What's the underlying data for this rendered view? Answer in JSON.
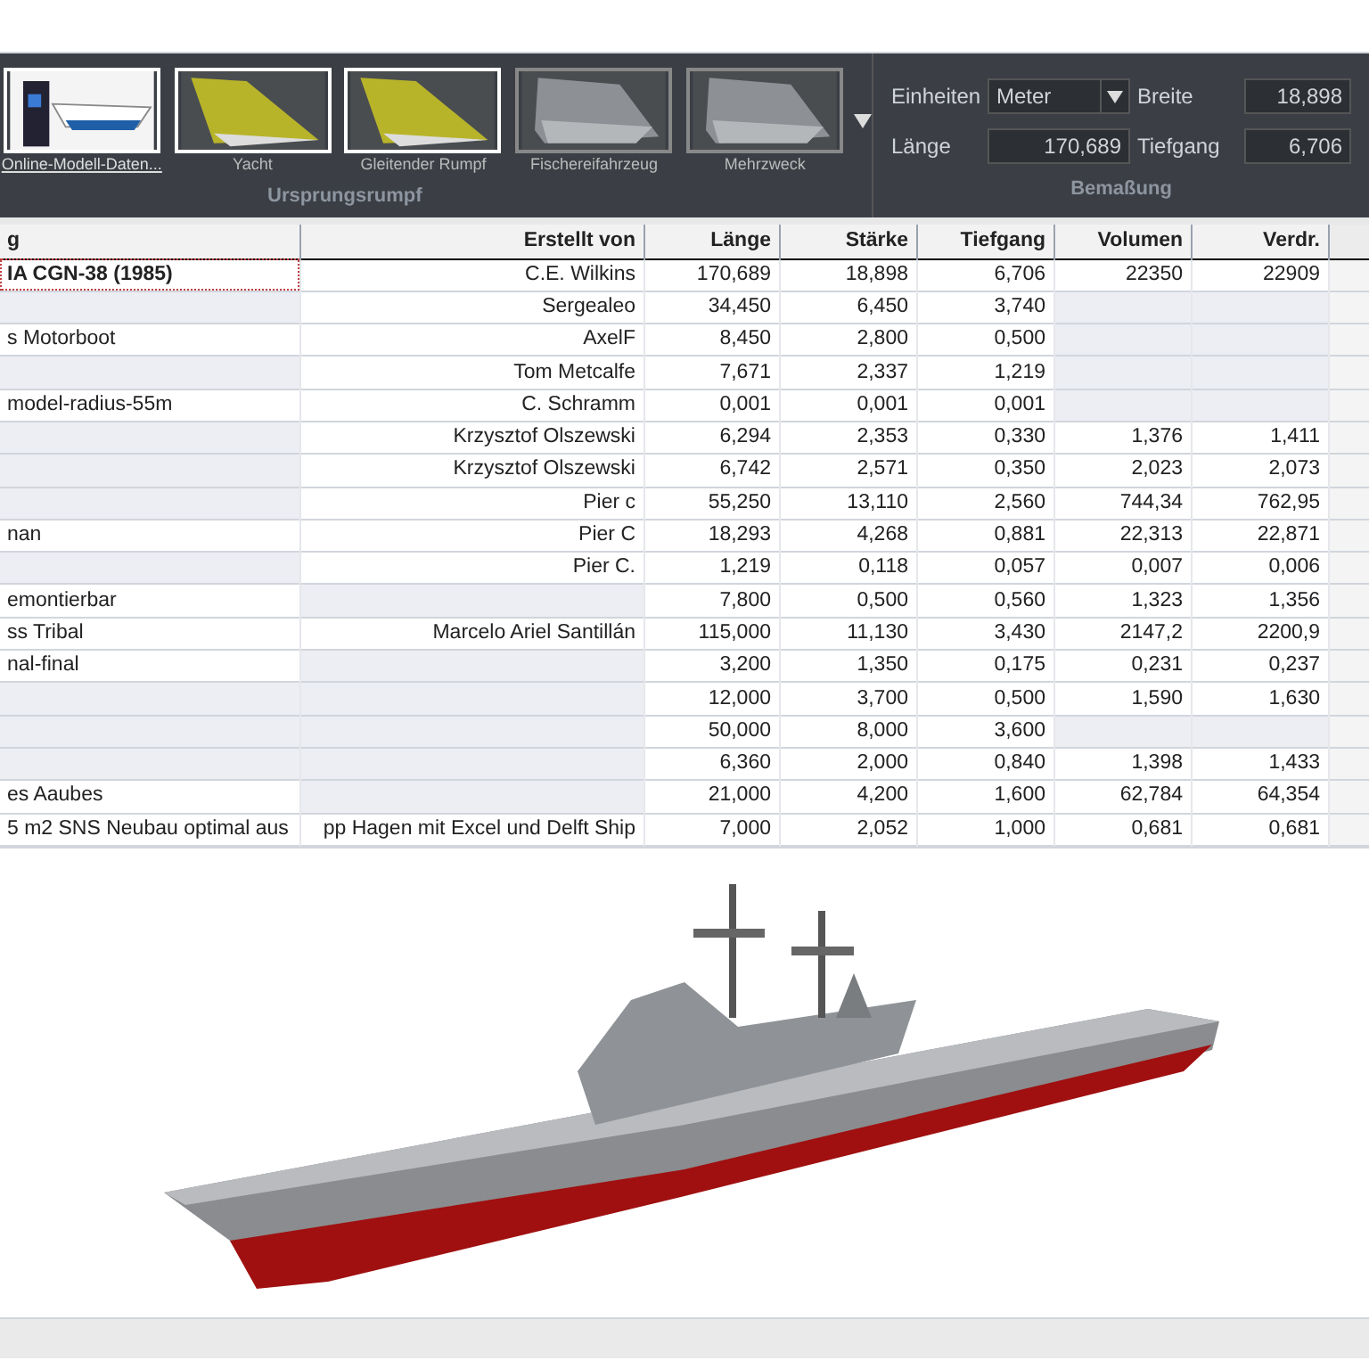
{
  "gallery": {
    "items": [
      {
        "label": "Online-Modell-Daten...",
        "kind": "online"
      },
      {
        "label": "Yacht",
        "kind": "yellow"
      },
      {
        "label": "Gleitender Rumpf",
        "kind": "yellow"
      },
      {
        "label": "Fischereifahrzeug",
        "kind": "grey"
      },
      {
        "label": "Mehrzweck",
        "kind": "grey"
      }
    ],
    "title": "Ursprungsrumpf"
  },
  "dimensions": {
    "title": "Bemaßung",
    "units_label": "Einheiten",
    "units_value": "Meter",
    "width_label": "Breite",
    "width_value": "18,898",
    "length_label": "Länge",
    "length_value": "170,689",
    "draft_label": "Tiefgang",
    "draft_value": "6,706"
  },
  "table": {
    "columns": [
      "g",
      "Erstellt von",
      "Länge",
      "Stärke",
      "Tiefgang",
      "Volumen",
      "Verdr."
    ],
    "rows": [
      {
        "selected": true,
        "cells": [
          "IA CGN-38 (1985)",
          "C.E. Wilkins",
          "170,689",
          "18,898",
          "6,706",
          "22350",
          "22909"
        ]
      },
      {
        "selected": false,
        "cells": [
          null,
          "Sergealeo",
          "34,450",
          "6,450",
          "3,740",
          null,
          null
        ]
      },
      {
        "selected": false,
        "cells": [
          "s Motorboot",
          "AxelF",
          "8,450",
          "2,800",
          "0,500",
          null,
          null
        ]
      },
      {
        "selected": false,
        "cells": [
          null,
          "Tom Metcalfe",
          "7,671",
          "2,337",
          "1,219",
          null,
          null
        ]
      },
      {
        "selected": false,
        "cells": [
          "model-radius-55m",
          "C. Schramm",
          "0,001",
          "0,001",
          "0,001",
          null,
          null
        ]
      },
      {
        "selected": false,
        "cells": [
          null,
          "Krzysztof Olszewski",
          "6,294",
          "2,353",
          "0,330",
          "1,376",
          "1,411"
        ]
      },
      {
        "selected": false,
        "cells": [
          null,
          "Krzysztof Olszewski",
          "6,742",
          "2,571",
          "0,350",
          "2,023",
          "2,073"
        ]
      },
      {
        "selected": false,
        "cells": [
          null,
          "Pier c",
          "55,250",
          "13,110",
          "2,560",
          "744,34",
          "762,95"
        ]
      },
      {
        "selected": false,
        "cells": [
          "nan",
          "Pier C",
          "18,293",
          "4,268",
          "0,881",
          "22,313",
          "22,871"
        ]
      },
      {
        "selected": false,
        "cells": [
          null,
          "Pier C.",
          "1,219",
          "0,118",
          "0,057",
          "0,007",
          "0,006"
        ]
      },
      {
        "selected": false,
        "cells": [
          "emontierbar",
          null,
          "7,800",
          "0,500",
          "0,560",
          "1,323",
          "1,356"
        ]
      },
      {
        "selected": false,
        "cells": [
          "ss Tribal",
          "Marcelo Ariel Santillán",
          "115,000",
          "11,130",
          "3,430",
          "2147,2",
          "2200,9"
        ]
      },
      {
        "selected": false,
        "cells": [
          "nal-final",
          null,
          "3,200",
          "1,350",
          "0,175",
          "0,231",
          "0,237"
        ]
      },
      {
        "selected": false,
        "cells": [
          null,
          null,
          "12,000",
          "3,700",
          "0,500",
          "1,590",
          "1,630"
        ]
      },
      {
        "selected": false,
        "cells": [
          null,
          null,
          "50,000",
          "8,000",
          "3,600",
          null,
          null
        ]
      },
      {
        "selected": false,
        "cells": [
          null,
          null,
          "6,360",
          "2,000",
          "0,840",
          "1,398",
          "1,433"
        ]
      },
      {
        "selected": false,
        "cells": [
          "es Aaubes",
          null,
          "21,000",
          "4,200",
          "1,600",
          "62,784",
          "64,354"
        ]
      },
      {
        "selected": false,
        "cells": [
          "5 m2 SNS Neubau optimal aus",
          "pp Hagen mit Excel und Delft Ship",
          "7,000",
          "2,052",
          "1,000",
          "0,681",
          "0,681"
        ]
      }
    ]
  }
}
